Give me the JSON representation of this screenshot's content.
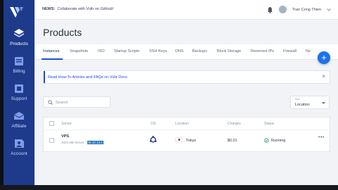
{
  "topbar": {
    "news_label": "NEWS:",
    "news_text": "Collaborate with Vultr on GitHub!",
    "user_name": "Tran Cong Thien"
  },
  "sidebar": {
    "items": [
      {
        "label": "Products",
        "icon": "products-icon",
        "active": true
      },
      {
        "label": "Billing",
        "icon": "billing-icon",
        "active": false
      },
      {
        "label": "Support",
        "icon": "support-icon",
        "active": false
      },
      {
        "label": "Affiliate",
        "icon": "affiliate-icon",
        "active": false
      },
      {
        "label": "Account",
        "icon": "account-icon",
        "active": false
      }
    ]
  },
  "page": {
    "title": "Products"
  },
  "tabs": [
    {
      "label": "Instances",
      "active": true
    },
    {
      "label": "Snapshots"
    },
    {
      "label": "ISO"
    },
    {
      "label": "Startup Scripts"
    },
    {
      "label": "SSH Keys"
    },
    {
      "label": "DNS"
    },
    {
      "label": "Backups"
    },
    {
      "label": "Block Storage"
    },
    {
      "label": "Reserved IPs"
    },
    {
      "label": "Firewall"
    },
    {
      "label": "Ne"
    }
  ],
  "fab_label": "+",
  "banner": {
    "text": "Read How-To Articles and FAQs on Vultr Docs",
    "close": "×"
  },
  "search": {
    "placeholder": "Search"
  },
  "sort": {
    "caption": "Sort",
    "value": "Location"
  },
  "table": {
    "headers": {
      "server": "Server",
      "os": "OS",
      "location": "Location",
      "charges": "Charges",
      "status": "Status"
    },
    "rows": [
      {
        "name": "VPS",
        "desc": "1024 MB Server - ",
        "ip": "45.32.13.6",
        "location": "Tokyo",
        "charges": "$0.01",
        "status": "Running",
        "more": "•••"
      }
    ]
  },
  "colors": {
    "sidebar": "#1e3a8a",
    "accent": "#1d4ed8",
    "status_green": "#22a06b"
  }
}
